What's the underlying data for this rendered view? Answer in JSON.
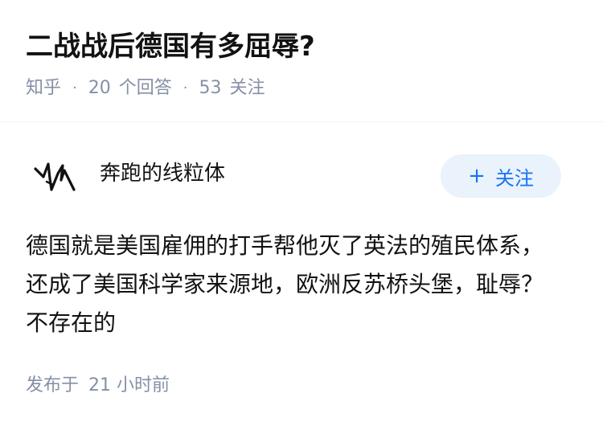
{
  "question": {
    "title": "二战战后德国有多屈辱?",
    "source": "知乎",
    "answer_count": "20",
    "answer_label": "个回答",
    "follow_count": "53",
    "follow_label": "关注",
    "separator": "·"
  },
  "answer": {
    "author_name": "奔跑的线粒体",
    "avatar_icon": "handwritten-scribble-avatar",
    "follow_button": {
      "plus": "+",
      "label": "关注"
    },
    "body": "德国就是美国雇佣的打手帮他灭了英法的殖民体系，还成了美国科学家来源地，欧洲反苏桥头堡，耻辱？不存在的",
    "publish_prefix": "发布于",
    "publish_time": "21 小时前"
  },
  "colors": {
    "text_primary": "#121212",
    "text_secondary": "#8590a6",
    "accent": "#1772f6",
    "button_bg": "#eaf2fb"
  }
}
